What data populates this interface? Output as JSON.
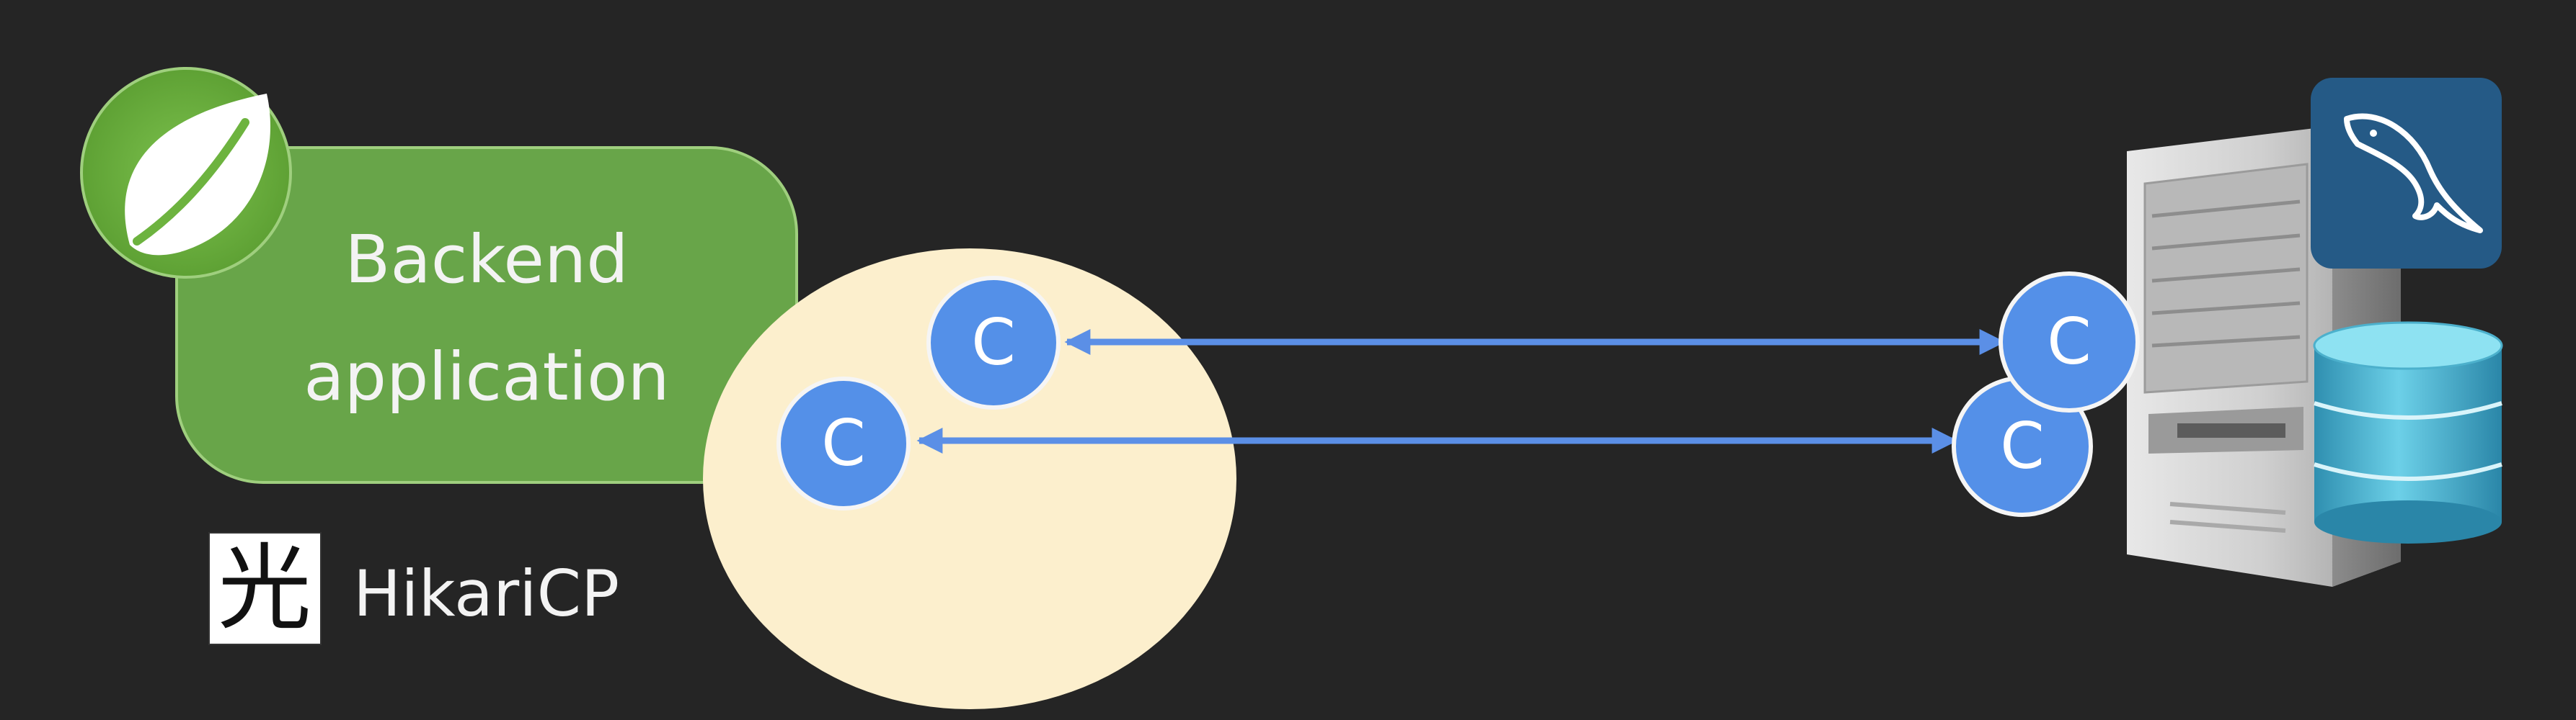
{
  "colors": {
    "background": "#252525",
    "backend_box": "#68a549",
    "spring_leaf_bg": "#6db33f",
    "pool_fill": "#fcefcd",
    "connection": "#5490e8",
    "arrow": "#5b8fe6",
    "mysql_tile": "#255a86",
    "db_cylinder": "#4cb0cc",
    "server_body": "#c9c9c9"
  },
  "backend": {
    "label_line1": "Backend",
    "label_line2": "application"
  },
  "pool": {
    "brand_glyph": "光",
    "brand_name": "HikariCP"
  },
  "connections": {
    "label": "C"
  },
  "icons": {
    "spring": "spring-leaf-icon",
    "mysql": "mysql-dolphin-icon",
    "database": "database-cylinder-icon",
    "server": "server-tower-icon"
  }
}
